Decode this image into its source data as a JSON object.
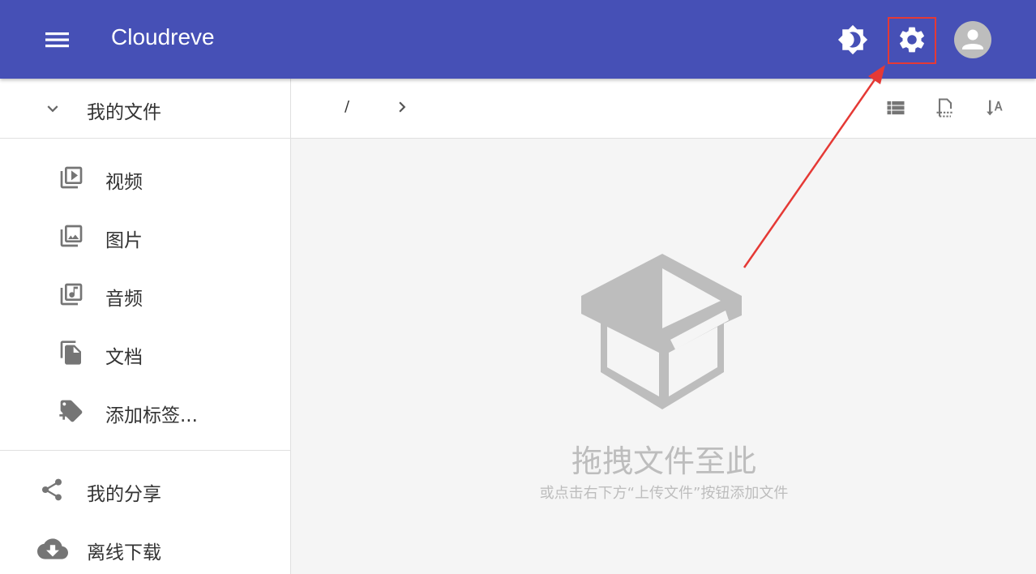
{
  "app": {
    "title": "Cloudreve"
  },
  "colors": {
    "appbar": "#4650b6",
    "highlight": "#e53935",
    "icon_gray": "#757575"
  },
  "header": {
    "icons": [
      "menu-icon",
      "brightness-icon",
      "settings-icon",
      "account-icon"
    ]
  },
  "sidebar": {
    "my_files": "我的文件",
    "items": [
      {
        "label": "视频",
        "icon": "video-library-icon"
      },
      {
        "label": "图片",
        "icon": "photo-library-icon"
      },
      {
        "label": "音频",
        "icon": "music-library-icon"
      },
      {
        "label": "文档",
        "icon": "documents-icon"
      },
      {
        "label": "添加标签...",
        "icon": "add-tag-icon"
      }
    ],
    "bottom": [
      {
        "label": "我的分享",
        "icon": "share-icon"
      },
      {
        "label": "离线下载",
        "icon": "cloud-download-icon"
      }
    ]
  },
  "breadcrumb": {
    "root": "/"
  },
  "empty": {
    "title": "拖拽文件至此",
    "hint": "或点击右下方“上传文件”按钮添加文件"
  }
}
